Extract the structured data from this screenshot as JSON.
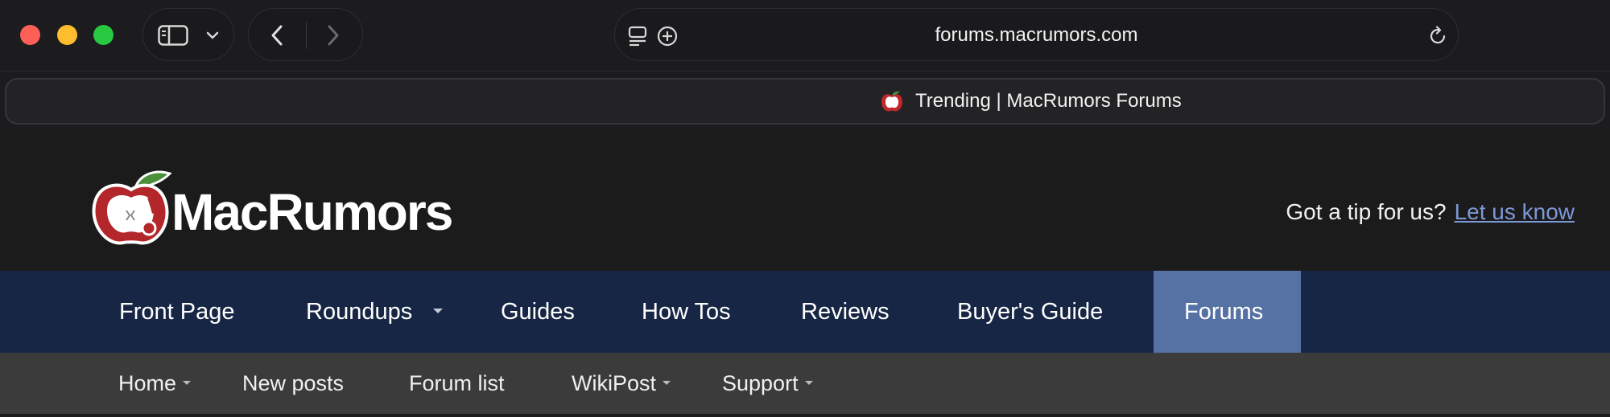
{
  "browser": {
    "url": "forums.macrumors.com",
    "tab_title": "Trending | MacRumors Forums",
    "traffic_lights": {
      "close": "#fe5f57",
      "minimize": "#febc2e",
      "zoom": "#28c840"
    },
    "icons": {
      "sidebar": "sidebar-icon",
      "sidebar_menu": "chevron-down-icon",
      "back": "chevron-left-icon",
      "forward": "chevron-right-icon",
      "page_menu": "page-menu-icon",
      "add": "plus-circle-icon",
      "reload": "reload-icon"
    }
  },
  "header": {
    "brand": "MacRumors",
    "tip_text": "Got a tip for us?",
    "tip_link": "Let us know"
  },
  "main_nav": {
    "items": [
      {
        "label": "Front Page",
        "dropdown": false,
        "active": false
      },
      {
        "label": "Roundups",
        "dropdown": true,
        "active": false
      },
      {
        "label": "Guides",
        "dropdown": false,
        "active": false
      },
      {
        "label": "How Tos",
        "dropdown": false,
        "active": false
      },
      {
        "label": "Reviews",
        "dropdown": false,
        "active": false
      },
      {
        "label": "Buyer's Guide",
        "dropdown": false,
        "active": false
      },
      {
        "label": "Forums",
        "dropdown": false,
        "active": true
      }
    ]
  },
  "sub_nav": {
    "items": [
      {
        "label": "Home",
        "dropdown": true
      },
      {
        "label": "New posts",
        "dropdown": false
      },
      {
        "label": "Forum list",
        "dropdown": false
      },
      {
        "label": "WikiPost",
        "dropdown": true
      },
      {
        "label": "Support",
        "dropdown": true
      }
    ]
  },
  "colors": {
    "nav_background": "#172644",
    "nav_active": "#5672a5",
    "subnav_background": "#3b3b3b",
    "link": "#7d98d7",
    "logo_red": "#b3262a",
    "logo_green": "#4a8f3a"
  }
}
